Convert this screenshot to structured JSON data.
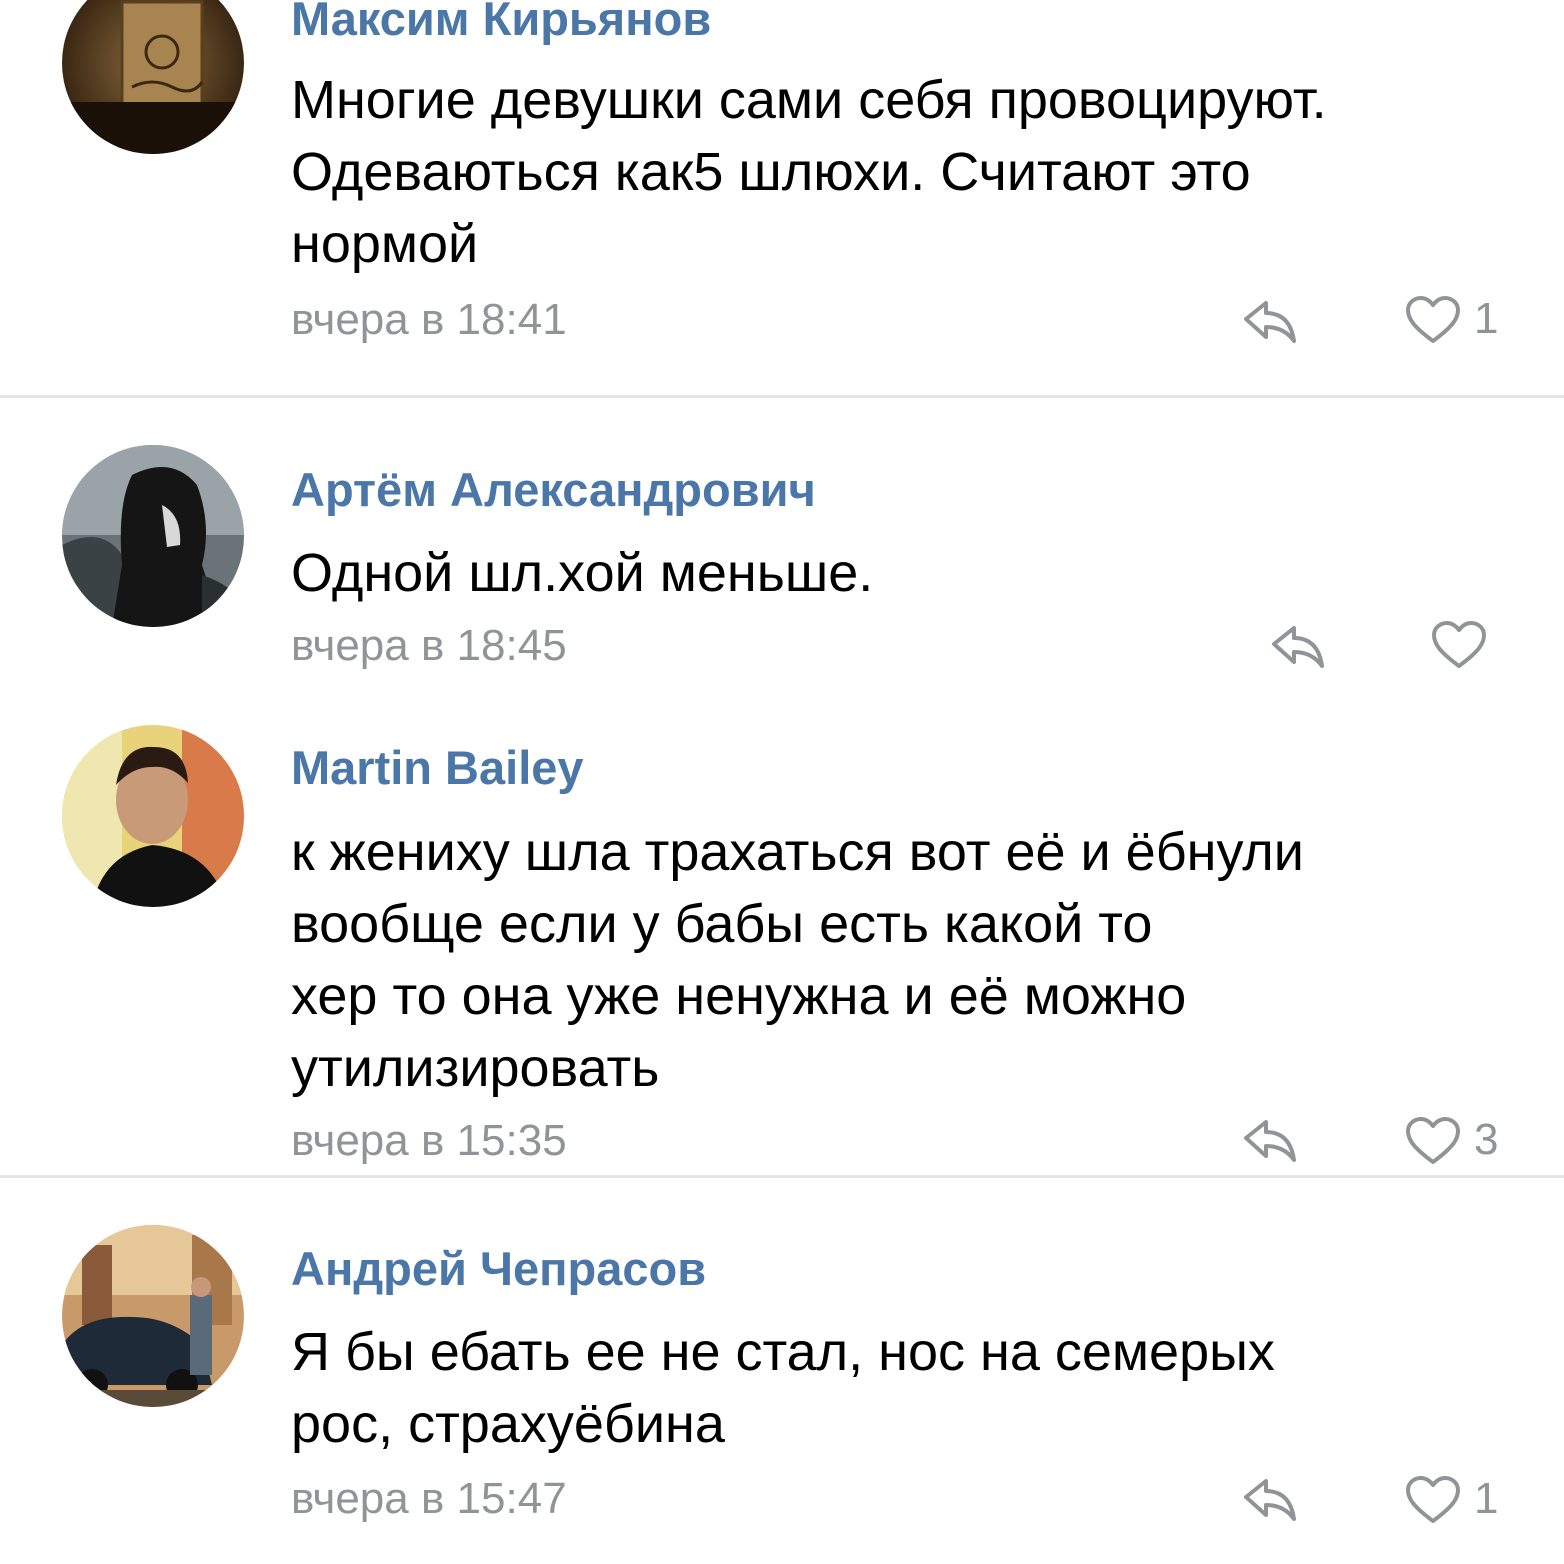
{
  "comments": [
    {
      "author": "Максим Кирьянов",
      "lines": [
        "Многие девушки сами себя провоцируют.",
        "Одеваються как5 шлюхи. Считают это",
        "нормой"
      ],
      "time": "вчера в 18:41",
      "likes": "1",
      "avatar_icon": "avatar-book-photo"
    },
    {
      "author": "Артём Александрович",
      "lines": [
        "Одной шл.хой меньше."
      ],
      "time": "вчера в 18:45",
      "likes": "",
      "avatar_icon": "avatar-hooded-figure-photo"
    },
    {
      "author": "Martin Bailey",
      "lines": [
        "к жениху шла трахаться вот её и ёбнули",
        "вообще если у бабы есть какой то",
        "хер то она уже ненужна и её можно",
        "утилизировать"
      ],
      "time": "вчера в 15:35",
      "likes": "3",
      "avatar_icon": "avatar-man-selfie-photo"
    },
    {
      "author": "Андрей Чепрасов",
      "lines": [
        "Я бы ебать ее не стал, нос на семерых",
        "рос, страхуёбина"
      ],
      "time": "вчера в 15:47",
      "likes": "1",
      "avatar_icon": "avatar-man-with-car-photo"
    }
  ],
  "colors": {
    "author": "#4a76a8",
    "meta": "#909499",
    "divider": "#e3e5e8",
    "text": "#000000"
  }
}
